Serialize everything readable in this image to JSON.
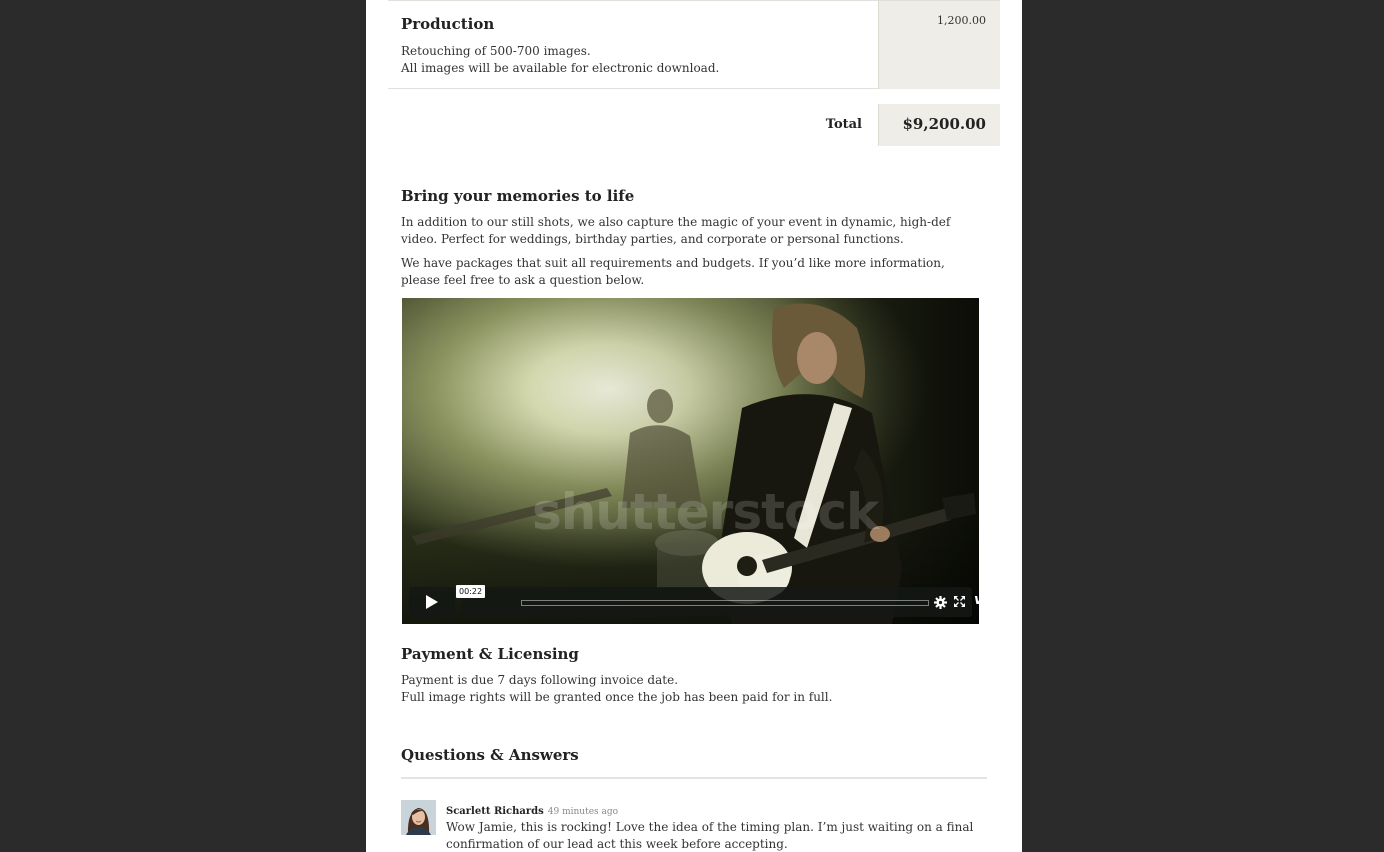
{
  "line_item": {
    "title": "Production",
    "lines": [
      "Retouching of 500-700 images.",
      "All images will be available for electronic download."
    ],
    "amount": "1,200.00"
  },
  "total": {
    "label": "Total",
    "value": "$9,200.00"
  },
  "video_section": {
    "heading": "Bring your memories to life",
    "paragraphs": [
      "In addition to our still shots, we also capture the magic of your event in dynamic, high-def video. Perfect for weddings, birthday parties, and corporate or personal functions.",
      "We have packages that suit all requirements and budgets. If you’d like more information, please feel free to ask a question below."
    ],
    "video": {
      "watermark": "shutterstock",
      "timecode": "00:22",
      "brand": "vimeo",
      "icons": [
        "play-icon",
        "settings-gear-icon",
        "fullscreen-icon"
      ]
    }
  },
  "payment": {
    "heading": "Payment & Licensing",
    "lines": [
      "Payment is due 7 days following invoice date.",
      "Full image rights will be granted once the job has been paid for in full."
    ]
  },
  "qa": {
    "heading": "Questions & Answers",
    "comments": [
      {
        "author": "Scarlett Richards",
        "time": "49 minutes ago",
        "text": "Wow Jamie, this is rocking! Love the idea of the timing plan. I’m just waiting on a final confirmation of our lead act this week before accepting."
      }
    ]
  }
}
